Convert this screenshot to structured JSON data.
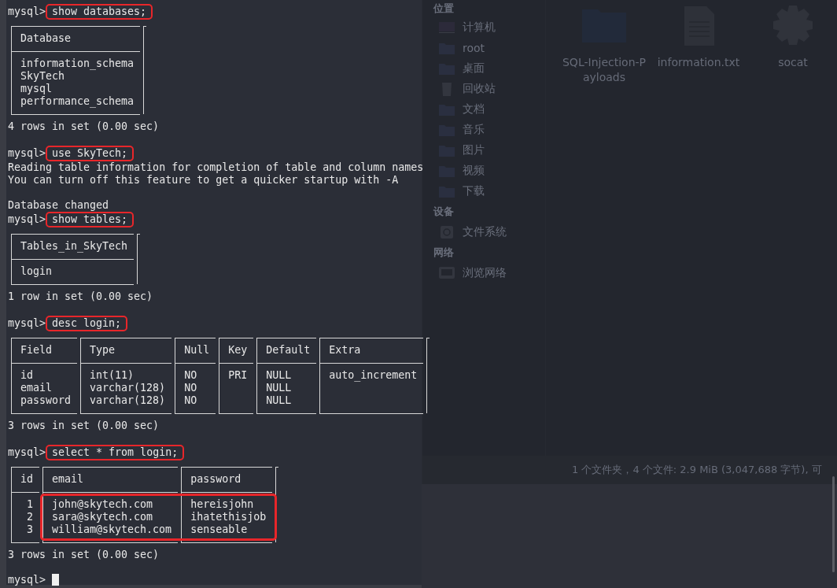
{
  "terminal": {
    "blocks": [
      {
        "prompt": "mysql>",
        "command": "show databases;",
        "highlighted": true,
        "output": [
          {
            "kind": "table",
            "columns": [
              {
                "label": "Database"
              }
            ],
            "rows": [
              [
                "information_schema"
              ],
              [
                "SkyTech"
              ],
              [
                "mysql"
              ],
              [
                "performance_schema"
              ]
            ]
          },
          {
            "kind": "text",
            "text": "4 rows in set (0.00 sec)"
          },
          {
            "kind": "blank"
          }
        ]
      },
      {
        "prompt": "mysql>",
        "command": "use SkyTech;",
        "highlighted": true,
        "output": [
          {
            "kind": "text",
            "text": "Reading table information for completion of table and column names"
          },
          {
            "kind": "text",
            "text": "You can turn off this feature to get a quicker startup with -A"
          },
          {
            "kind": "blank"
          },
          {
            "kind": "text",
            "text": "Database changed"
          }
        ]
      },
      {
        "prompt": "mysql>",
        "command": "show tables;",
        "highlighted": true,
        "output": [
          {
            "kind": "table",
            "columns": [
              {
                "label": "Tables_in_SkyTech"
              }
            ],
            "rows": [
              [
                "login"
              ]
            ]
          },
          {
            "kind": "text",
            "text": "1 row in set (0.00 sec)"
          },
          {
            "kind": "blank"
          }
        ]
      },
      {
        "prompt": "mysql>",
        "command": "desc login;",
        "highlighted": true,
        "output": [
          {
            "kind": "table",
            "columns": [
              {
                "label": "Field"
              },
              {
                "label": "Type"
              },
              {
                "label": "Null"
              },
              {
                "label": "Key"
              },
              {
                "label": "Default"
              },
              {
                "label": "Extra"
              }
            ],
            "rows": [
              [
                "id",
                "int(11)",
                "NO",
                "PRI",
                "NULL",
                "auto_increment"
              ],
              [
                "email",
                "varchar(128)",
                "NO",
                "",
                "NULL",
                ""
              ],
              [
                "password",
                "varchar(128)",
                "NO",
                "",
                "NULL",
                ""
              ]
            ]
          },
          {
            "kind": "text",
            "text": "3 rows in set (0.00 sec)"
          },
          {
            "kind": "blank"
          }
        ]
      },
      {
        "prompt": "mysql>",
        "command": "select * from login;",
        "highlighted": true,
        "output": [
          {
            "kind": "table",
            "columns": [
              {
                "label": "id",
                "right_aligned": true
              },
              {
                "label": "email"
              },
              {
                "label": "password"
              }
            ],
            "rows": [
              [
                "1",
                "john@skytech.com",
                "hereisjohn"
              ],
              [
                "2",
                "sara@skytech.com",
                "ihatethisjob"
              ],
              [
                "3",
                "william@skytech.com",
                "senseable"
              ]
            ],
            "data_highlighted": true
          },
          {
            "kind": "text",
            "text": "3 rows in set (0.00 sec)"
          },
          {
            "kind": "blank"
          }
        ]
      },
      {
        "prompt": "mysql>",
        "cursor": true
      }
    ]
  },
  "file_manager": {
    "sidebar": [
      {
        "heading": "位置",
        "items": [
          {
            "label": "计算机",
            "kind": "computer"
          },
          {
            "label": "root",
            "kind": "folder"
          },
          {
            "label": "桌面",
            "kind": "folder"
          },
          {
            "label": "回收站",
            "kind": "trash"
          },
          {
            "label": "文档",
            "kind": "folder"
          },
          {
            "label": "音乐",
            "kind": "folder"
          },
          {
            "label": "图片",
            "kind": "folder"
          },
          {
            "label": "视频",
            "kind": "folder"
          },
          {
            "label": "下载",
            "kind": "folder"
          }
        ]
      },
      {
        "heading": "设备",
        "items": [
          {
            "label": "文件系统",
            "kind": "disk"
          }
        ]
      },
      {
        "heading": "网络",
        "items": [
          {
            "label": "浏览网络",
            "kind": "network"
          }
        ]
      }
    ],
    "files": [
      {
        "name": "SQL-Injection-Payloads",
        "kind": "folder"
      },
      {
        "name": "information.txt",
        "kind": "document"
      },
      {
        "name": "socat",
        "kind": "executable"
      }
    ],
    "status": "1 个文件夹，4 个文件: 2.9 MiB (3,047,688 字节), 可"
  }
}
